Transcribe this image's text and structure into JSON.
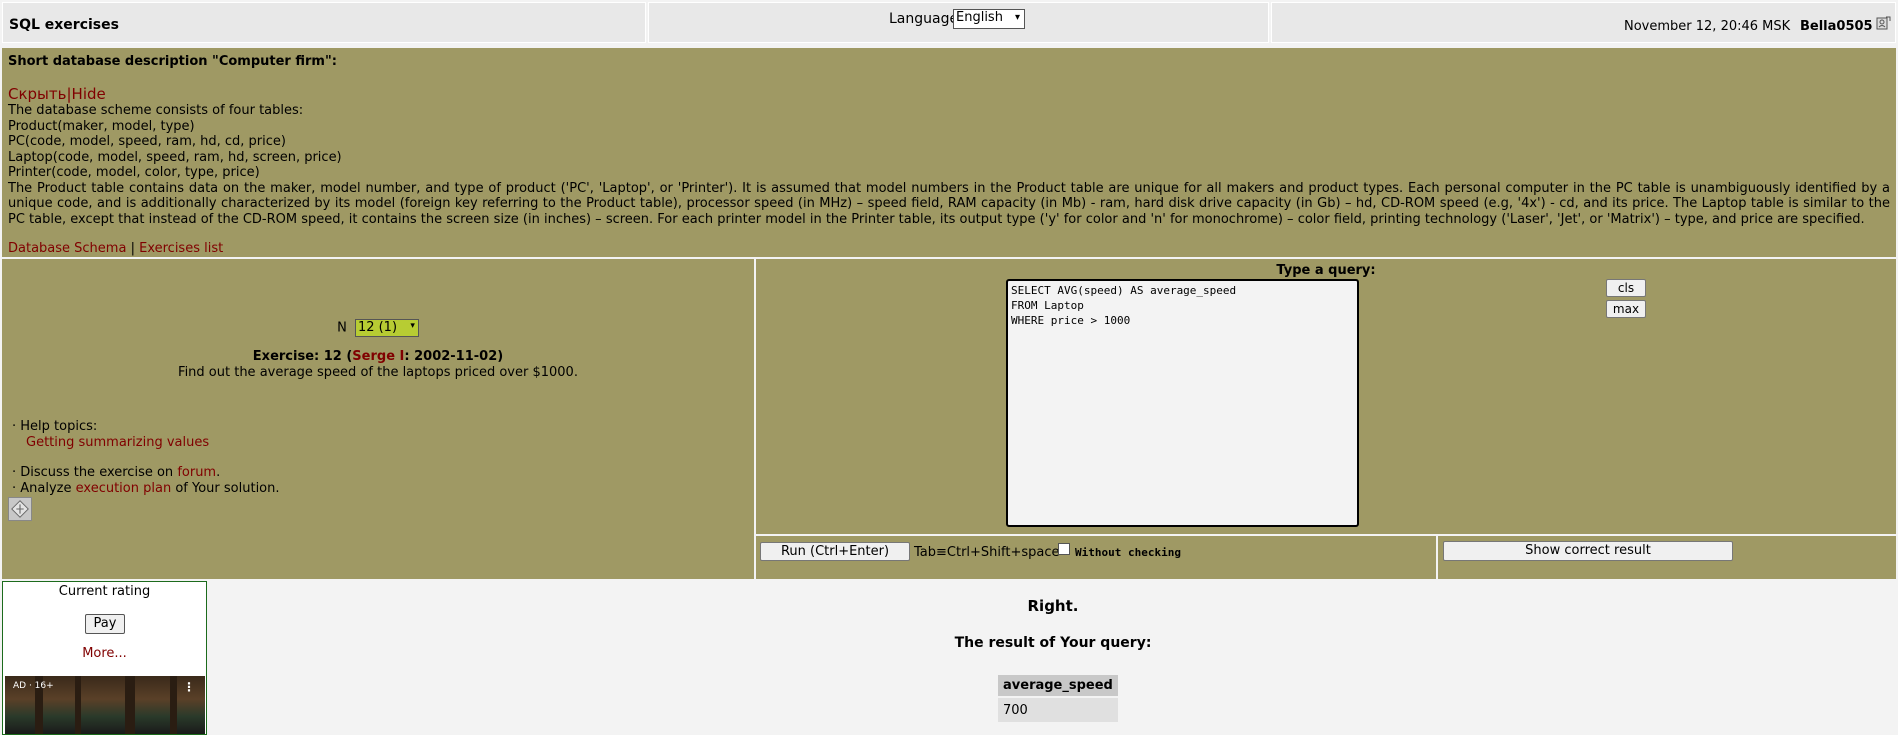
{
  "header": {
    "app_title": "SQL exercises",
    "language_label": "Language",
    "language_value": "English",
    "datetime": "November 12, 20:46 MSK",
    "username": "Bella0505"
  },
  "description": {
    "title": "Short database description \"Computer firm\":",
    "toggle_ru": "Скрыть",
    "toggle_sep": "|",
    "toggle_en": "Hide",
    "scheme_intro": "The database scheme consists of four tables:",
    "tables": [
      "Product(maker, model, type)",
      "PC(code, model, speed, ram, hd, cd, price)",
      "Laptop(code, model, speed, ram, hd, screen, price)",
      "Printer(code, model, color, type, price)"
    ],
    "paragraph": "The Product table contains data on the maker, model number, and type of product ('PC', 'Laptop', or 'Printer'). It is assumed that model numbers in the Product table are unique for all makers and product types. Each personal computer in the PC table is unambiguously identified by a unique code, and is additionally characterized by its model (foreign key referring to the Product table), processor speed (in MHz) – speed field, RAM capacity (in Mb) - ram, hard disk drive capacity (in Gb) – hd, CD-ROM speed (e.g, '4x') - cd, and its price. The Laptop table is similar to the PC table, except that instead of the CD-ROM speed, it contains the screen size (in inches) – screen. For each printer model in the Printer table, its output type ('y' for color and 'n' for monochrome) – color field, printing technology ('Laser', 'Jet', or 'Matrix') – type, and price are specified.",
    "schema_link": "Database Schema",
    "links_sep": "|",
    "exercises_link": "Exercises list"
  },
  "exercise": {
    "n_label": "N",
    "n_value": "12 (1)",
    "title_prefix": "Exercise: 12 (",
    "author": "Serge I",
    "title_suffix": ": 2002-11-02)",
    "text": "Find out the average speed of the laptops priced over $1000.",
    "help_label": "· Help topics:",
    "help_link": "Getting summarizing values",
    "discuss_prefix": "· Discuss the exercise on",
    "discuss_link": "forum",
    "discuss_suffix": ".",
    "analyze_prefix": "· Analyze",
    "analyze_link": "execution plan",
    "analyze_suffix": "of Your solution."
  },
  "query": {
    "label": "Type a query:",
    "text": "SELECT AVG(speed) AS average_speed\nFROM Laptop\nWHERE price > 1000",
    "cls_label": "cls",
    "max_label": "max",
    "run_label": "Run (Ctrl+Enter)",
    "tab_hint": "Tab≡Ctrl+Shift+space",
    "without_checking_label": "Without checking",
    "without_checking_checked": false,
    "show_result_label": "Show correct result"
  },
  "rating": {
    "title": "Current rating",
    "pay_label": "Pay",
    "more_label": "More...",
    "ad_label": "AD · 16+",
    "ad_menu": "⋮"
  },
  "result": {
    "status": "Right.",
    "title": "The result of Your query:",
    "columns": [
      "average_speed"
    ],
    "rows": [
      [
        "700"
      ]
    ]
  }
}
